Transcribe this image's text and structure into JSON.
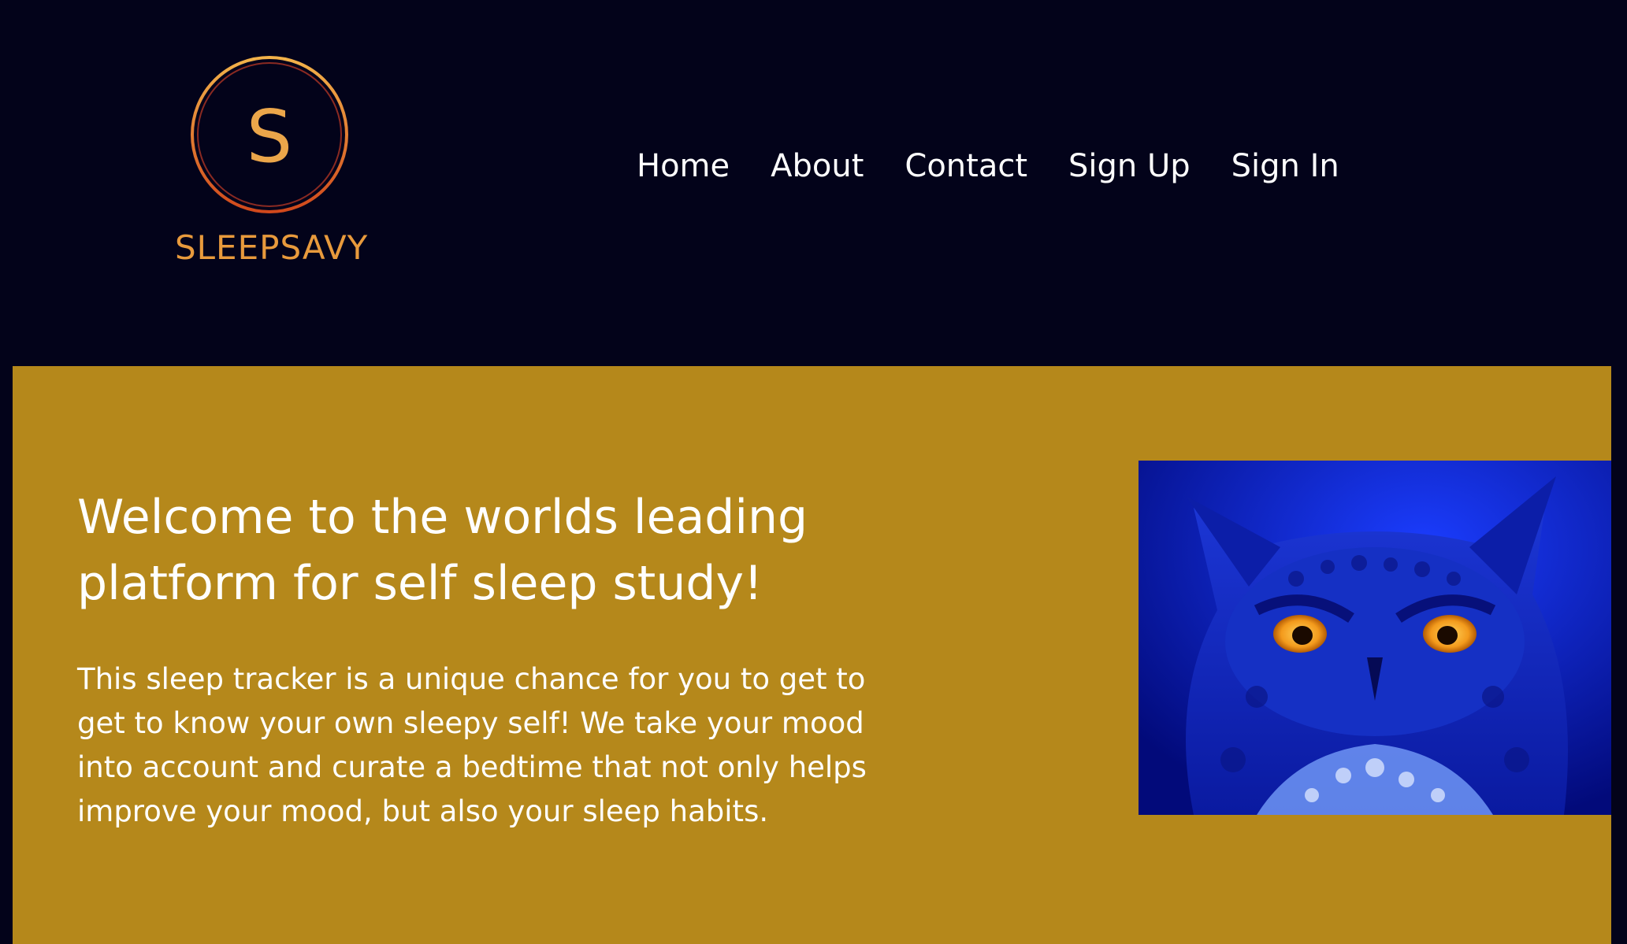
{
  "brand": {
    "logo_letter": "S",
    "name": "SLEEPSAVY"
  },
  "nav": {
    "items": [
      {
        "label": "Home"
      },
      {
        "label": "About"
      },
      {
        "label": "Contact"
      },
      {
        "label": "Sign Up"
      },
      {
        "label": "Sign In"
      }
    ]
  },
  "hero": {
    "title": "Welcome to the worlds leading platform for self sleep study!",
    "body": "This sleep tracker is a unique chance for you to get to get to know your own sleepy self! We take your mood into account and curate a bedtime that not only helps improve your mood, but also your sleep habits.",
    "image_icon": "owl-photo"
  },
  "colors": {
    "header_bg": "#03031a",
    "hero_bg": "#b5881b",
    "accent": "#e89a3c"
  }
}
